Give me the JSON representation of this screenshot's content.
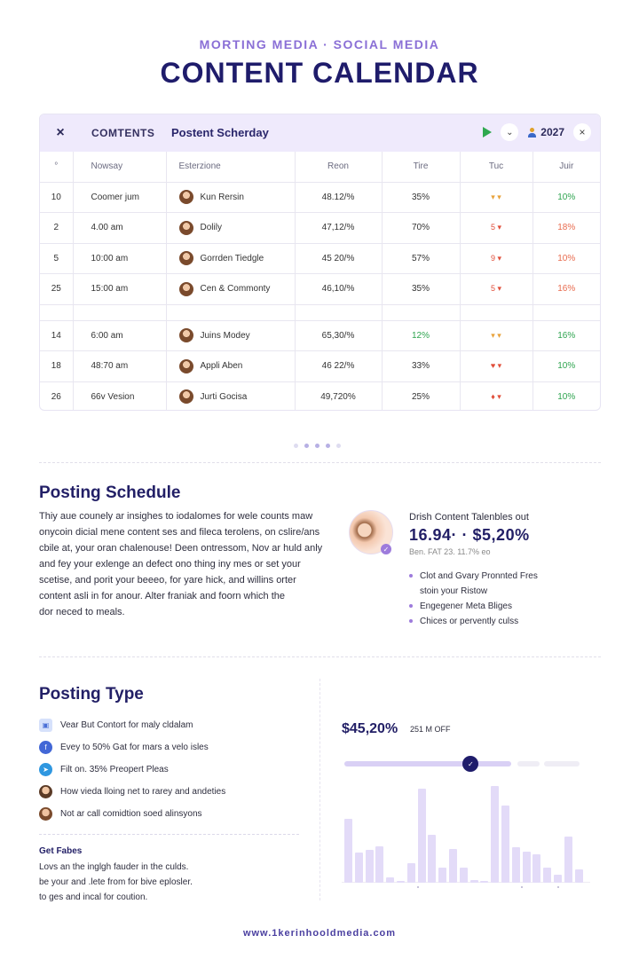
{
  "header": {
    "supertitle": "MORTING MEDIA · SOCIAL MEDIA",
    "title": "CONTENT CALENDAR"
  },
  "toolbar": {
    "close_icon": "×",
    "contents_label": "COMTENTS",
    "schedule_label": "Postent Scherday",
    "year": "2027",
    "chevron": "⌄",
    "close2": "×"
  },
  "table": {
    "headers": [
      "°",
      "Nowsay",
      "Esterzione",
      "Reon",
      "Tire",
      "Tuc",
      "Juir"
    ],
    "rows": [
      {
        "idx": "10",
        "name": "Coomer jum",
        "ent": "Kun Rersin",
        "reach": "48.12/%",
        "time": "35%",
        "tue": "▾ ▾",
        "tue_kind": "up",
        "jul": "10%",
        "jul_kind": "green"
      },
      {
        "idx": "2",
        "name": "4.00 am",
        "ent": "Dolily",
        "reach": "47,12/%",
        "time": "70%",
        "tue": "5 ▾",
        "tue_kind": "down",
        "jul": "18%",
        "jul_kind": "red"
      },
      {
        "idx": "5",
        "name": "10:00 am",
        "ent": "Gorrden Tiedgle",
        "reach": "45 20/%",
        "time": "57%",
        "tue": "9 ▾",
        "tue_kind": "down",
        "jul": "10%",
        "jul_kind": "red"
      },
      {
        "idx": "25",
        "name": "15:00 am",
        "ent": "Cen & Commonty",
        "reach": "46,10/%",
        "time": "35%",
        "tue": "5 ▾",
        "tue_kind": "down",
        "jul": "16%",
        "jul_kind": "red"
      },
      {
        "gap": true
      },
      {
        "idx": "14",
        "name": "6:00 am",
        "ent": "Juins Modey",
        "reach": "65,30/%",
        "time": "12%",
        "time_kind": "green",
        "tue": "▾ ▾",
        "tue_kind": "up",
        "jul": "16%",
        "jul_kind": "green"
      },
      {
        "idx": "18",
        "name": "48:70 am",
        "ent": "Appli Aben",
        "reach": "46 22/%",
        "time": "33%",
        "tue": "♥ ▾",
        "tue_kind": "down",
        "jul": "10%",
        "jul_kind": "green"
      },
      {
        "idx": "26",
        "name": "66v Vesion",
        "ent": "Jurti Gocisa",
        "reach": "49,720%",
        "time": "25%",
        "tue": "♦ ▾",
        "tue_kind": "down",
        "jul": "10%",
        "jul_kind": "green"
      }
    ]
  },
  "posting_schedule": {
    "title": "Posting Schedule",
    "text": [
      "Thiy aue counely ar insighes to iodalomes for wele counts maw",
      "onycoin dicial mene content ses and fileca terolens, on cslire/ans",
      "cbile at, your oran chalenouse! Deen ontressom, Nov ar huld anly",
      "and fey your exlenge an defect ono thing iny mes or set your",
      "scetise, and porit your beeeo, for yare hick, and willins orter",
      "content asli in for anour. Alter franiak and foorn which the",
      "dor neced to meals."
    ],
    "side_subtitle": "Drish Content Talenbles out",
    "side_big": "16.94· · $5,20%",
    "side_small": "Ben. FAT 23. 11.7% eo",
    "bullets": [
      {
        "text": "Clot and Gvary Pronnted Fres",
        "dot": true
      },
      {
        "text": "stoin your Ristow",
        "dot": false
      },
      {
        "text": "Engegener Meta Bliges",
        "dot": true
      },
      {
        "text": "Chices or pervently culss",
        "dot": true
      }
    ]
  },
  "posting_type": {
    "title": "Posting Type",
    "items": [
      "Vear But Contort for maly cldalam",
      "Evey to 50% Gat for mars a velo isles",
      "Filt on. 35% Preopert Pleas",
      "How vieda lloing net to rarey and andeties",
      "Not ar call comidtion soed alinsyons"
    ],
    "icons": [
      "image-icon",
      "facebook-icon",
      "telegram-icon",
      "person-avatar-icon",
      "person-avatar-icon"
    ],
    "get_title": "Get Fabes",
    "get_text": [
      "Lovs an the inglgh fauder in the culds.",
      "be your and .lete from for bive eplosler.",
      "to ges and incal for coution."
    ],
    "big_value": "$45,20%",
    "off_label": "251 M OFF",
    "slider_fraction": 0.53,
    "bar_values": [
      64,
      30,
      33,
      37,
      5,
      2,
      20,
      95,
      48,
      15,
      34,
      15,
      3,
      2,
      97,
      78,
      36,
      31,
      29,
      15,
      8,
      46,
      13
    ]
  },
  "footer": "www.1kerinhooldmedia.com"
}
